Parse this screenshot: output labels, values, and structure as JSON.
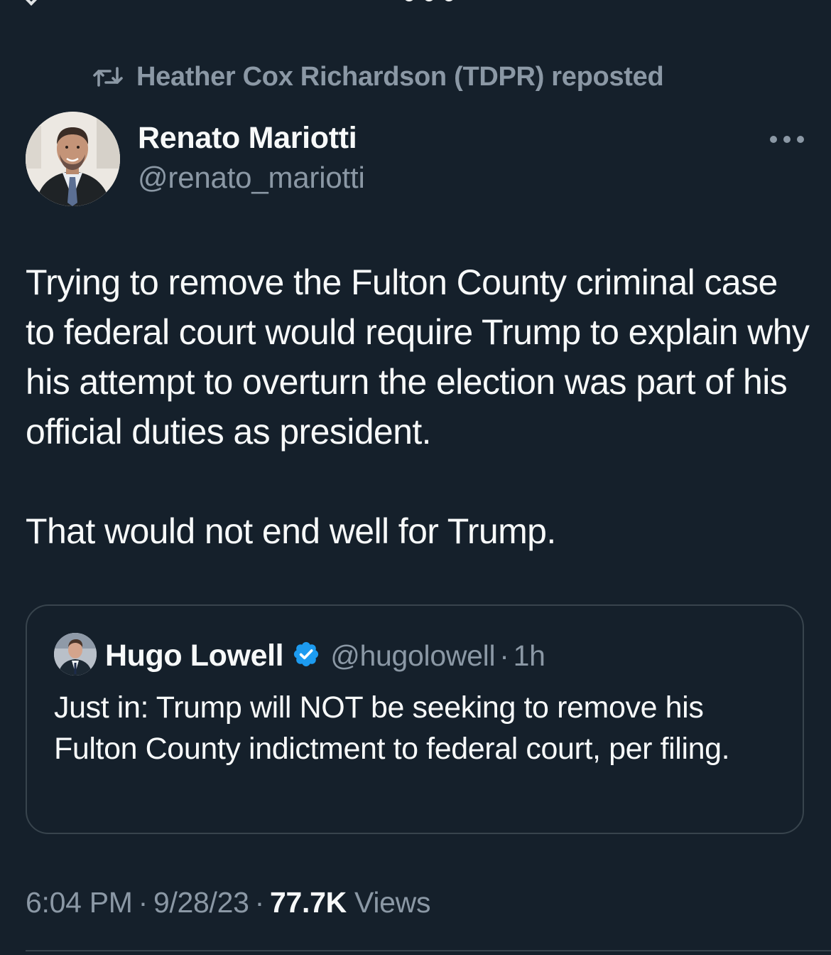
{
  "repost": {
    "label": "Heather Cox Richardson (TDPR) reposted",
    "icon": "repost-icon"
  },
  "author": {
    "name": "Renato Mariotti",
    "handle": "@renato_mariotti",
    "avatar": "avatar-man-suit-portrait"
  },
  "tweet": {
    "paragraphs": [
      "Trying to remove the Fulton County criminal case to federal court would require Trump to explain why his attempt to overturn the election was part of his official duties as president.",
      "That would not end well for Trump."
    ]
  },
  "quote": {
    "name": "Hugo Lowell",
    "verified": true,
    "handle": "@hugolowell",
    "separator": "·",
    "time": "1h",
    "text": "Just in: Trump will NOT be seeking to remove his Fulton County indictment to federal court, per filing."
  },
  "meta": {
    "time": "6:04 PM",
    "separator": "·",
    "date": "9/28/23",
    "views_count": "77.7K",
    "views_label": "Views"
  },
  "colors": {
    "background": "#15202b",
    "primary_text": "#f7f9f9",
    "secondary_text": "#8b98a5",
    "border": "#38444d",
    "verified_blue": "#1d9bf0"
  }
}
